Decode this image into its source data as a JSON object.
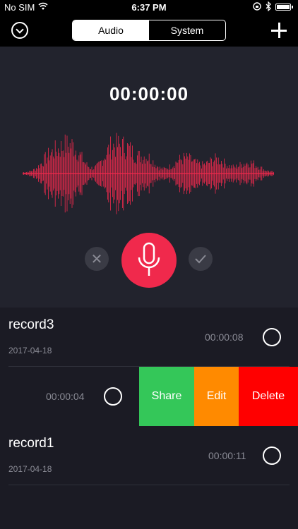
{
  "status": {
    "carrier": "No SIM",
    "time": "6:37 PM"
  },
  "nav": {
    "tabs": [
      {
        "label": "Audio",
        "active": true
      },
      {
        "label": "System",
        "active": false
      }
    ]
  },
  "recorder": {
    "timer": "00:00:00"
  },
  "records": [
    {
      "name": "record3",
      "date": "2017-04-18",
      "duration": "00:00:08"
    },
    {
      "name": "",
      "date": "",
      "duration": "00:00:04",
      "swiped": true
    },
    {
      "name": "record1",
      "date": "2017-04-18",
      "duration": "00:00:11"
    }
  ],
  "swipe_actions": {
    "share": "Share",
    "edit": "Edit",
    "delete": "Delete"
  },
  "colors": {
    "accent": "#f0294c",
    "share": "#34c759",
    "edit": "#ff8a00",
    "delete": "#ff0000"
  }
}
